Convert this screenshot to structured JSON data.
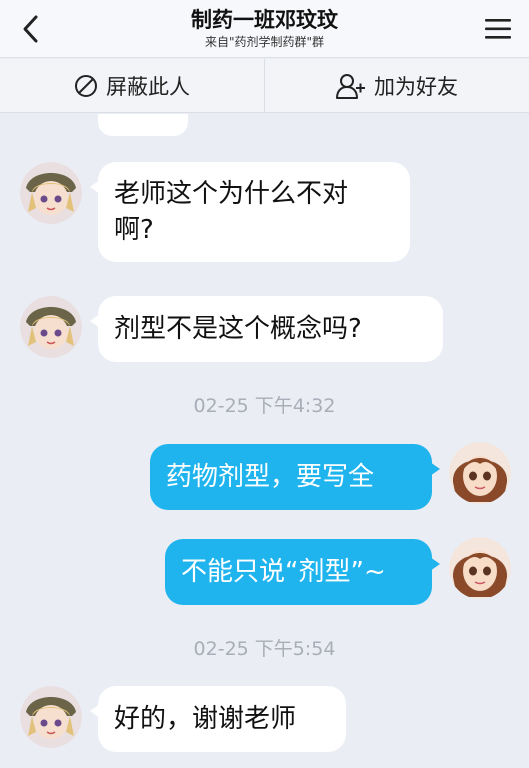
{
  "header": {
    "title": "制药一班邓玟玟",
    "subtitle": "来自\"药剂学制药群\"群",
    "back_icon": "chevron-left-icon",
    "menu_icon": "hamburger-menu-icon"
  },
  "actions": {
    "block_label": "屏蔽此人",
    "block_icon": "block-icon",
    "add_friend_label": "加为好友",
    "add_friend_icon": "add-user-icon"
  },
  "messages": [
    {
      "side": "in",
      "text_line1": "老师这个为什么不对",
      "text_line2": "啊?"
    },
    {
      "side": "in",
      "text": "剂型不是这个概念吗?"
    },
    {
      "type": "time",
      "text": "02-25 下午4:32"
    },
    {
      "side": "out",
      "text": "药物剂型，要写全"
    },
    {
      "side": "out",
      "text": "不能只说“剂型”~"
    },
    {
      "type": "time",
      "text": "02-25 下午5:54"
    },
    {
      "side": "in",
      "text": "好的，谢谢老师"
    }
  ],
  "colors": {
    "background": "#ebedf5",
    "outgoing_bubble": "#1fb4ee",
    "incoming_bubble": "#ffffff",
    "timestamp": "#a9adb8"
  }
}
